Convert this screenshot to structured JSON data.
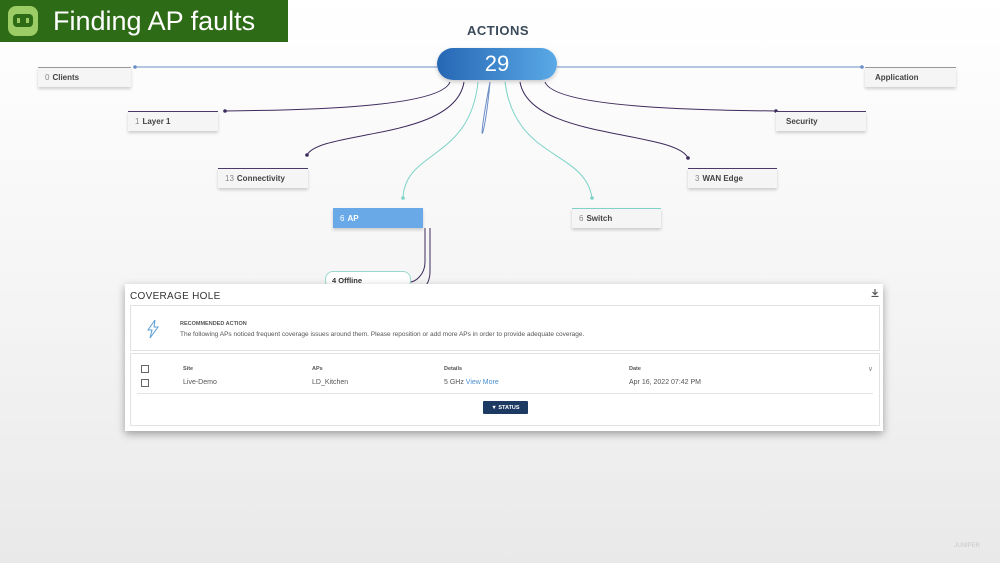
{
  "banner": {
    "title": "Finding AP faults",
    "icon": "robot-icon"
  },
  "actions": {
    "title": "ACTIONS",
    "total": "29"
  },
  "nodes": {
    "clients": {
      "count": "0",
      "label": "Clients"
    },
    "application": {
      "count": "",
      "label": "Application"
    },
    "layer1": {
      "count": "1",
      "label": "Layer 1"
    },
    "security": {
      "count": "",
      "label": "Security"
    },
    "connectivity": {
      "count": "13",
      "label": "Connectivity"
    },
    "wan_edge": {
      "count": "3",
      "label": "WAN Edge"
    },
    "ap": {
      "count": "6",
      "label": "AP"
    },
    "switch": {
      "count": "6",
      "label": "Switch"
    }
  },
  "offline": {
    "count": "4",
    "label": "Offline"
  },
  "panel": {
    "title": "COVERAGE HOLE",
    "recommended_heading": "RECOMMENDED ACTION",
    "recommended_text": "The following APs noticed frequent coverage issues around them. Please reposition or add more APs in order to provide adequate coverage.",
    "columns": [
      "Site",
      "APs",
      "Details",
      "Date"
    ],
    "rows": [
      {
        "site": "Live-Demo",
        "aps": "LD_Kitchen",
        "details": "5 GHz",
        "link": "View More",
        "date": "Apr 16, 2022 07:42 PM"
      }
    ],
    "status_button": "▼ STATUS"
  },
  "watermark": "JUNIPER",
  "colors": {
    "banner": "#2e6b16",
    "accent": "#2667b4",
    "teal_line": "#7dd3c6",
    "purple_line": "#3d2b5c"
  }
}
